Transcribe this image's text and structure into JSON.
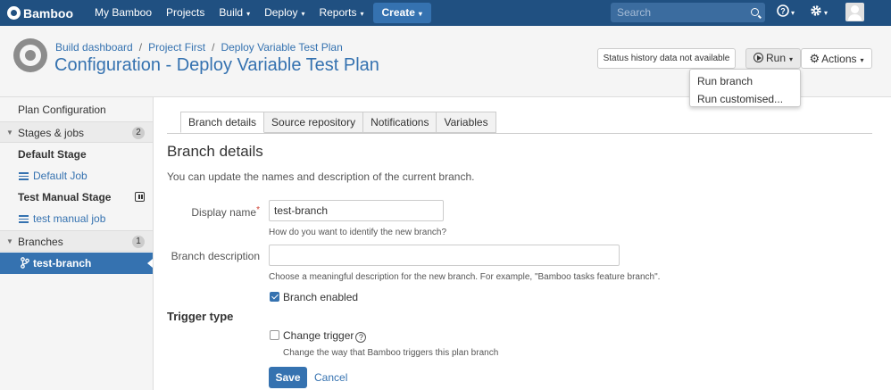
{
  "nav": {
    "brand": "Bamboo",
    "items": [
      {
        "label": "My Bamboo",
        "has_caret": false
      },
      {
        "label": "Projects",
        "has_caret": false
      },
      {
        "label": "Build",
        "has_caret": true
      },
      {
        "label": "Deploy",
        "has_caret": true
      },
      {
        "label": "Reports",
        "has_caret": true
      }
    ],
    "create_label": "Create",
    "search_placeholder": "Search",
    "help_icon": "help-icon",
    "settings_icon": "gear-icon",
    "caret": "▾"
  },
  "header": {
    "breadcrumbs": [
      "Build dashboard",
      "Project First",
      "Deploy Variable Test Plan"
    ],
    "title": "Configuration - Deploy Variable Test Plan",
    "status_button": "Status history data not available",
    "run_button": "Run",
    "actions_button": "Actions"
  },
  "run_menu": {
    "items": [
      "Run branch",
      "Run customised..."
    ]
  },
  "sidebar": {
    "plan_configuration": "Plan Configuration",
    "stages_label": "Stages & jobs",
    "stages_count": "2",
    "default_stage": "Default Stage",
    "default_job": "Default Job",
    "manual_stage": "Test Manual Stage",
    "manual_job": "test manual job",
    "branches_label": "Branches",
    "branches_count": "1",
    "selected_branch": "test-branch"
  },
  "tabs": [
    "Branch details",
    "Source repository",
    "Notifications",
    "Variables"
  ],
  "form": {
    "section_title": "Branch details",
    "intro": "You can update the names and description of the current branch.",
    "display_name_label": "Display name",
    "display_name_value": "test-branch",
    "display_name_hint": "How do you want to identify the new branch?",
    "description_label": "Branch description",
    "description_value": "",
    "description_hint": "Choose a meaningful description for the new branch. For example, \"Bamboo tasks feature branch\".",
    "enabled_label": "Branch enabled",
    "enabled": true,
    "trigger_title": "Trigger type",
    "change_trigger_label": "Change trigger",
    "change_trigger_checked": false,
    "change_trigger_hint": "Change the way that Bamboo triggers this plan branch",
    "save_label": "Save",
    "cancel_label": "Cancel"
  },
  "colors": {
    "nav_bg": "#205081",
    "link": "#3572b0",
    "primary_button": "#3572b0",
    "required": "#d04437"
  }
}
